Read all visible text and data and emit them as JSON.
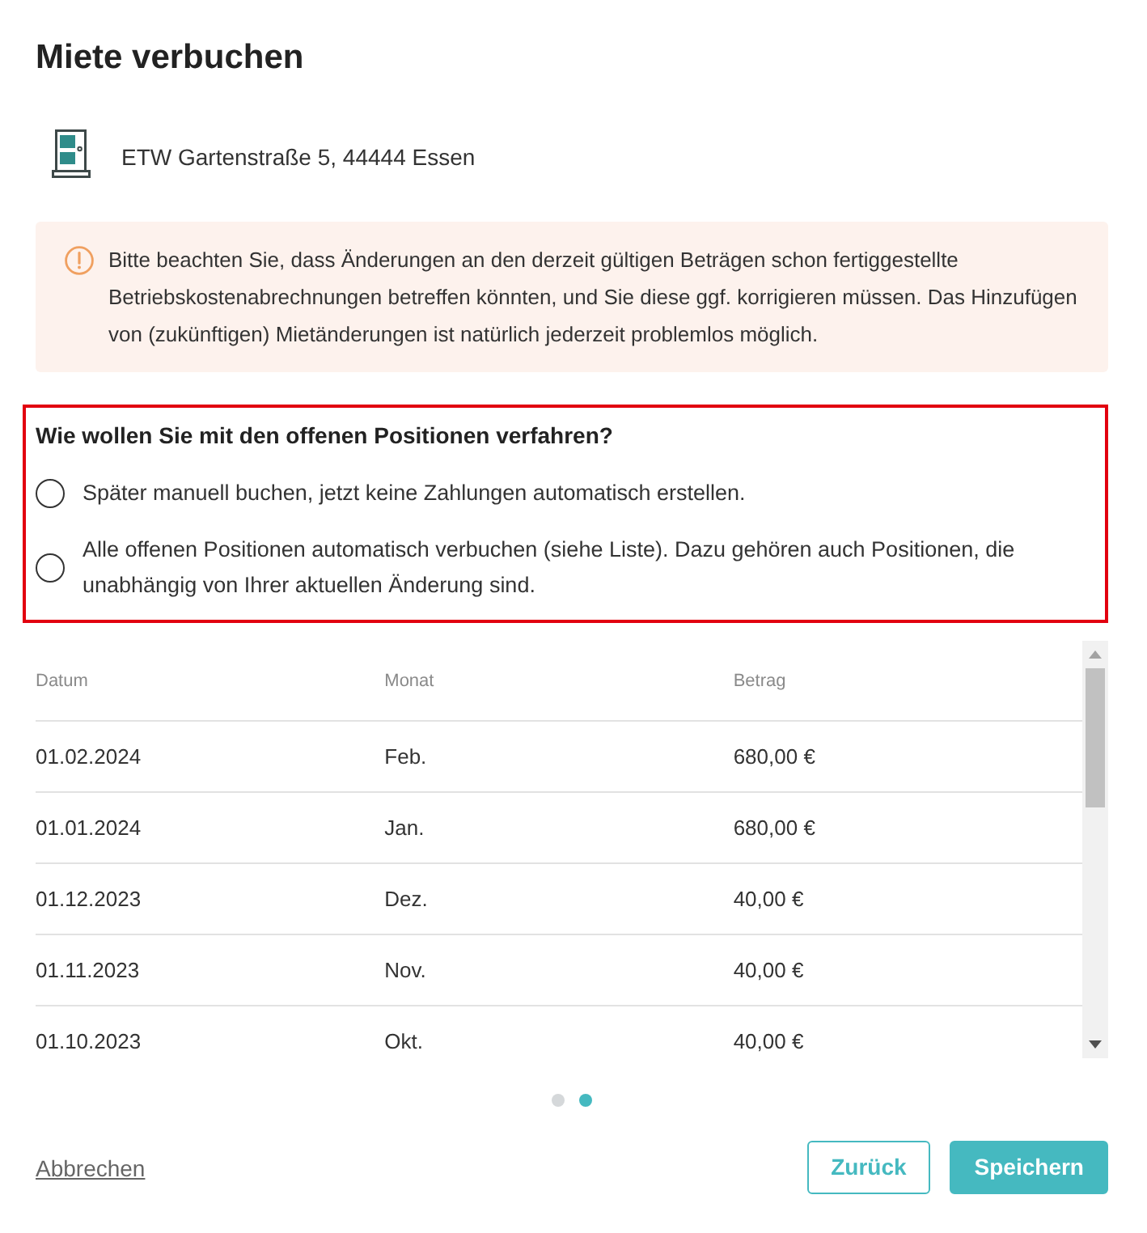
{
  "dialog": {
    "title": "Miete verbuchen"
  },
  "property": {
    "address": "ETW Gartenstraße 5, 44444 Essen"
  },
  "notice": {
    "text": "Bitte beachten Sie, dass Änderungen an den derzeit gültigen Beträgen schon fertiggestellte Betriebskostenabrechnungen betreffen könnten, und Sie diese ggf. korrigieren müssen. Das Hinzufügen von (zukünftigen) Mietänderungen ist natürlich jederzeit problemlos möglich."
  },
  "question": {
    "title": "Wie wollen Sie mit den offenen Positionen verfahren?",
    "error": true,
    "options": [
      {
        "label": "Später manuell buchen, jetzt keine Zahlungen automatisch erstellen.",
        "selected": false
      },
      {
        "label": "Alle offenen Positionen automatisch verbuchen (siehe Liste). Dazu gehören auch Positionen, die unabhängig von Ihrer aktuellen Änderung sind.",
        "selected": false
      }
    ]
  },
  "table": {
    "columns": [
      "Datum",
      "Monat",
      "Betrag"
    ],
    "rows": [
      [
        "01.02.2024",
        "Feb.",
        "680,00 €"
      ],
      [
        "01.01.2024",
        "Jan.",
        "680,00 €"
      ],
      [
        "01.12.2023",
        "Dez.",
        "40,00 €"
      ],
      [
        "01.11.2023",
        "Nov.",
        "40,00 €"
      ],
      [
        "01.10.2023",
        "Okt.",
        "40,00 €"
      ]
    ]
  },
  "steps": [
    {
      "selected": false
    },
    {
      "selected": true
    }
  ],
  "footer": {
    "cancel": "Abbrechen",
    "buttons": [
      {
        "label": "Zurück",
        "kind": "secondary"
      },
      {
        "label": "Speichern",
        "kind": "primary"
      }
    ]
  }
}
